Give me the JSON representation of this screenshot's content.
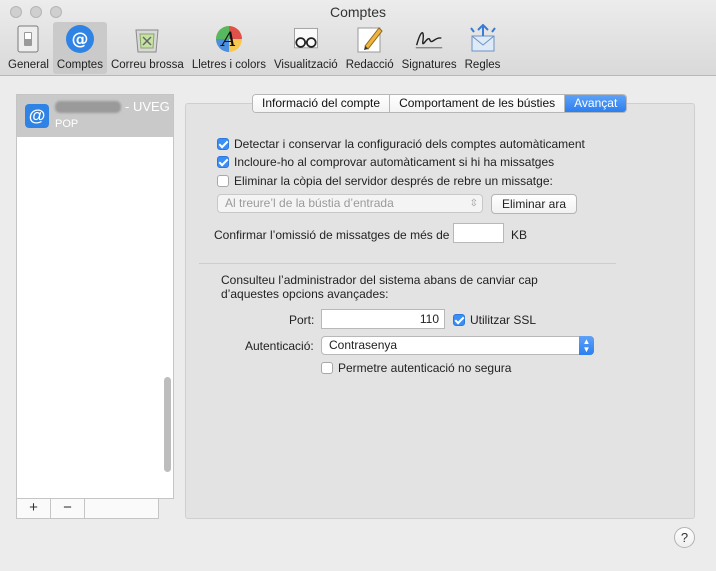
{
  "window": {
    "title": "Comptes"
  },
  "toolbar": {
    "items": [
      {
        "label": "General",
        "icon": "switch-icon"
      },
      {
        "label": "Comptes",
        "icon": "at-sign-icon",
        "active": true
      },
      {
        "label": "Correu brossa",
        "icon": "trash-icon"
      },
      {
        "label": "Lletres i colors",
        "icon": "font-icon"
      },
      {
        "label": "Visualització",
        "icon": "glasses-icon"
      },
      {
        "label": "Redacció",
        "icon": "pencil-icon"
      },
      {
        "label": "Signatures",
        "icon": "signature-icon"
      },
      {
        "label": "Regles",
        "icon": "rules-icon"
      }
    ]
  },
  "accounts": {
    "items": [
      {
        "name": "- UVEG",
        "type": "POP"
      }
    ],
    "add_label": "+",
    "remove_label": "−"
  },
  "tabs": {
    "items": [
      {
        "label": "Informació del compte"
      },
      {
        "label": "Comportament de les bústies"
      },
      {
        "label": "Avançat",
        "selected": true
      }
    ]
  },
  "advanced": {
    "detect_config": {
      "label": "Detectar i conservar la configuració dels comptes automàticament",
      "checked": true
    },
    "include_check": {
      "label": "Incloure-ho al comprovar automàticament si hi ha missatges",
      "checked": true
    },
    "delete_copy": {
      "label": "Eliminar la còpia del servidor després de rebre un missatge:",
      "checked": false
    },
    "delete_when": "Al treure’l de la bústia d’entrada",
    "delete_now_label": "Eliminar ara",
    "omit_label": "Confirmar l’omissió de missatges de més de",
    "omit_value": "",
    "omit_unit": "KB",
    "notice_line1": "Consulteu l’administrador del sistema abans de canviar cap",
    "notice_line2": "d’aquestes opcions avançades:",
    "port_label": "Port:",
    "port_value": "110",
    "ssl": {
      "label": "Utilitzar SSL",
      "checked": true
    },
    "auth_label": "Autenticació:",
    "auth_value": "Contrasenya",
    "insecure": {
      "label": "Permetre autenticació no segura",
      "checked": false
    }
  },
  "help_label": "?"
}
